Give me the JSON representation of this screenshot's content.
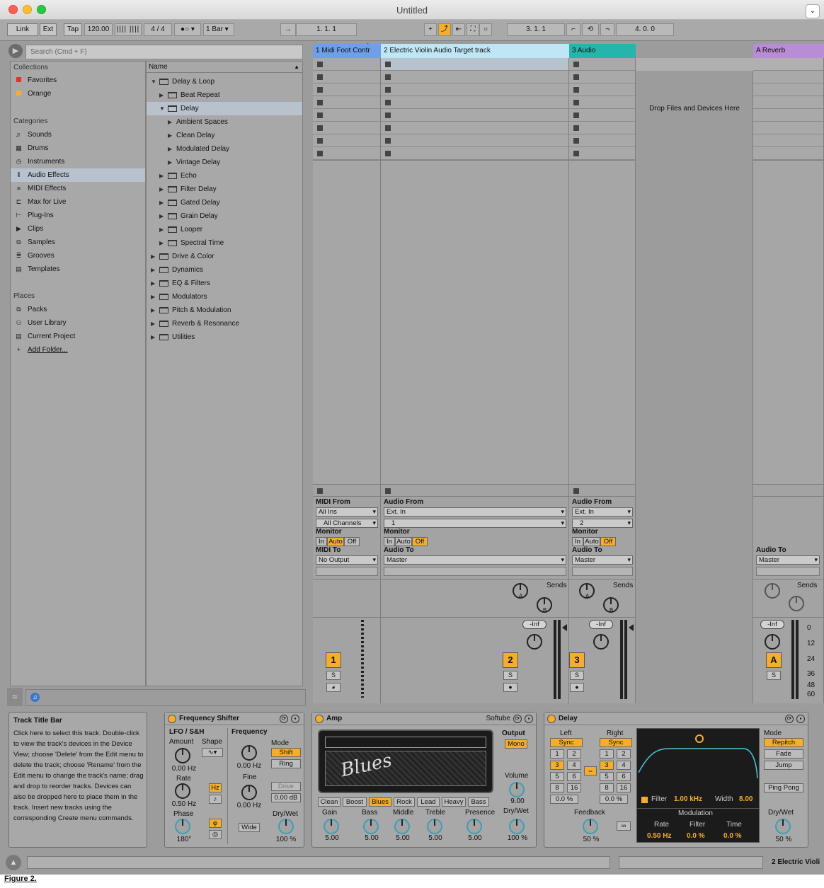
{
  "window": {
    "title": "Untitled"
  },
  "toolbar": {
    "link": "Link",
    "ext": "Ext",
    "tap": "Tap",
    "tempo": "120.00",
    "signature": "4 / 4",
    "quantize": "1 Bar",
    "arr_position": "1.   1.   1",
    "loop_start": "3.   1.   1",
    "loop_length": "4.   0.   0"
  },
  "browser": {
    "search_placeholder": "Search (Cmd + F)",
    "collections_header": "Collections",
    "collections": [
      {
        "label": "Favorites",
        "color": "#e0332a"
      },
      {
        "label": "Orange",
        "color": "#f5ae2c"
      }
    ],
    "categories_header": "Categories",
    "categories": [
      "Sounds",
      "Drums",
      "Instruments",
      "Audio Effects",
      "MIDI Effects",
      "Max for Live",
      "Plug-Ins",
      "Clips",
      "Samples",
      "Grooves",
      "Templates"
    ],
    "selected_category": "Audio Effects",
    "places_header": "Places",
    "places": [
      "Packs",
      "User Library",
      "Current Project",
      "Add Folder..."
    ],
    "name_header": "Name",
    "tree": [
      {
        "label": "Delay & Loop",
        "depth": 0,
        "state": "open",
        "folder": true
      },
      {
        "label": "Beat Repeat",
        "depth": 1,
        "state": "closed",
        "folder": true
      },
      {
        "label": "Delay",
        "depth": 1,
        "state": "open",
        "folder": true,
        "selected": true
      },
      {
        "label": "Ambient Spaces",
        "depth": 2,
        "state": "closed",
        "folder": false
      },
      {
        "label": "Clean Delay",
        "depth": 2,
        "state": "closed",
        "folder": false
      },
      {
        "label": "Modulated Delay",
        "depth": 2,
        "state": "closed",
        "folder": false
      },
      {
        "label": "Vintage Delay",
        "depth": 2,
        "state": "closed",
        "folder": false
      },
      {
        "label": "Echo",
        "depth": 1,
        "state": "closed",
        "folder": true
      },
      {
        "label": "Filter Delay",
        "depth": 1,
        "state": "closed",
        "folder": true
      },
      {
        "label": "Gated Delay",
        "depth": 1,
        "state": "closed",
        "folder": true
      },
      {
        "label": "Grain Delay",
        "depth": 1,
        "state": "closed",
        "folder": true
      },
      {
        "label": "Looper",
        "depth": 1,
        "state": "closed",
        "folder": true
      },
      {
        "label": "Spectral Time",
        "depth": 1,
        "state": "closed",
        "folder": true
      },
      {
        "label": "Drive & Color",
        "depth": 0,
        "state": "closed",
        "folder": true
      },
      {
        "label": "Dynamics",
        "depth": 0,
        "state": "closed",
        "folder": true
      },
      {
        "label": "EQ & Filters",
        "depth": 0,
        "state": "closed",
        "folder": true
      },
      {
        "label": "Modulators",
        "depth": 0,
        "state": "closed",
        "folder": true
      },
      {
        "label": "Pitch & Modulation",
        "depth": 0,
        "state": "closed",
        "folder": true
      },
      {
        "label": "Reverb & Resonance",
        "depth": 0,
        "state": "closed",
        "folder": true
      },
      {
        "label": "Utilities",
        "depth": 0,
        "state": "closed",
        "folder": true
      }
    ]
  },
  "session": {
    "drop_text": "Drop Files and Devices Here",
    "tracks": [
      {
        "name": "1 Midi Foot Contr",
        "color": "#6f9fe8",
        "type": "midi",
        "num": "1",
        "from_label": "MIDI From",
        "from": "All Ins",
        "channel": "All Channels",
        "to_label": "MIDI To",
        "to": "No Output",
        "monitor": "Auto"
      },
      {
        "name": "2 Electric Violin Audio Target track",
        "color": "#bfe6f5",
        "type": "audio",
        "num": "2",
        "from_label": "Audio From",
        "from": "Ext. In",
        "channel": "1",
        "to_label": "Audio To",
        "to": "Master",
        "monitor": "Off"
      },
      {
        "name": "3 Audio",
        "color": "#26b5ab",
        "type": "audio",
        "num": "3",
        "from_label": "Audio From",
        "from": "Ext. In",
        "channel": "2",
        "to_label": "Audio To",
        "to": "Master",
        "monitor": "Off"
      }
    ],
    "return": {
      "name": "A Reverb",
      "color": "#b98cd6",
      "num": "A",
      "to_label": "Audio To",
      "to": "Master"
    },
    "monitor_label": "Monitor",
    "monitor_opts": [
      "In",
      "Auto",
      "Off"
    ],
    "sends": "Sends",
    "send_a": "A",
    "send_b": "B",
    "volume": "-Inf",
    "solo": "S",
    "meter_scale": [
      "0",
      "12",
      "24",
      "36",
      "48",
      "60"
    ]
  },
  "info": {
    "title": "Track Title Bar",
    "text": "Click here to select this track. Double-click to view the track's devices in the Device View; choose 'Delete' from the Edit menu to delete the track; choose 'Rename' from the Edit menu to change the track's name; drag and drop to reorder tracks. Devices can also be dropped here to place them in the track. Insert new tracks using the corresponding Create menu commands."
  },
  "freq_shifter": {
    "title": "Frequency Shifter",
    "lfo": "LFO / S&H",
    "amount": "Amount",
    "amount_val": "0.00 Hz",
    "shape": "Shape",
    "rate": "Rate",
    "rate_val": "0.50 Hz",
    "hz": "Hz",
    "phase": "Phase",
    "phase_val": "180°",
    "frequency": "Frequency",
    "freq_val": "0.00 Hz",
    "fine": "Fine",
    "fine_val": "0.00 Hz",
    "wide": "Wide",
    "mode": "Mode",
    "shift": "Shift",
    "ring": "Ring",
    "drive": "Drive",
    "drive_val": "0.00 dB",
    "drywet": "Dry/Wet",
    "drywet_val": "100 %"
  },
  "amp": {
    "title": "Amp",
    "brand": "Softube",
    "logo": "Blues",
    "output": "Output",
    "mono": "Mono",
    "volume": "Volume",
    "volume_val": "9.00",
    "drywet": "Dry/Wet",
    "drywet_val": "100 %",
    "models": [
      "Clean",
      "Boost",
      "Blues",
      "Rock",
      "Lead",
      "Heavy",
      "Bass"
    ],
    "active_model": "Blues",
    "knobs": [
      {
        "label": "Gain",
        "val": "5.00"
      },
      {
        "label": "Bass",
        "val": "5.00"
      },
      {
        "label": "Middle",
        "val": "5.00"
      },
      {
        "label": "Treble",
        "val": "5.00"
      },
      {
        "label": "Presence",
        "val": "5.00"
      }
    ]
  },
  "delay": {
    "title": "Delay",
    "left": "Left",
    "right": "Right",
    "sync": "Sync",
    "grid": [
      "1",
      "2",
      "3",
      "4",
      "5",
      "6",
      "8",
      "16"
    ],
    "active_step": "3",
    "left_offset": "0.0 %",
    "right_offset": "0.0 %",
    "feedback": "Feedback",
    "feedback_val": "50 %",
    "freeze": "∞",
    "filter": "Filter",
    "filter_val": "1.00 kHz",
    "width": "Width",
    "width_val": "8.00",
    "modulation": "Modulation",
    "mod_rate": "Rate",
    "mod_rate_val": "0.50 Hz",
    "mod_filter": "Filter",
    "mod_filter_val": "0.0 %",
    "mod_time": "Time",
    "mod_time_val": "0.0 %",
    "mode": "Mode",
    "repitch": "Repitch",
    "fade": "Fade",
    "jump": "Jump",
    "ping_pong": "Ping Pong",
    "drywet": "Dry/Wet",
    "drywet_val": "50 %"
  },
  "status": {
    "track_name": "2 Electric Violi"
  },
  "caption": "Figure 2."
}
